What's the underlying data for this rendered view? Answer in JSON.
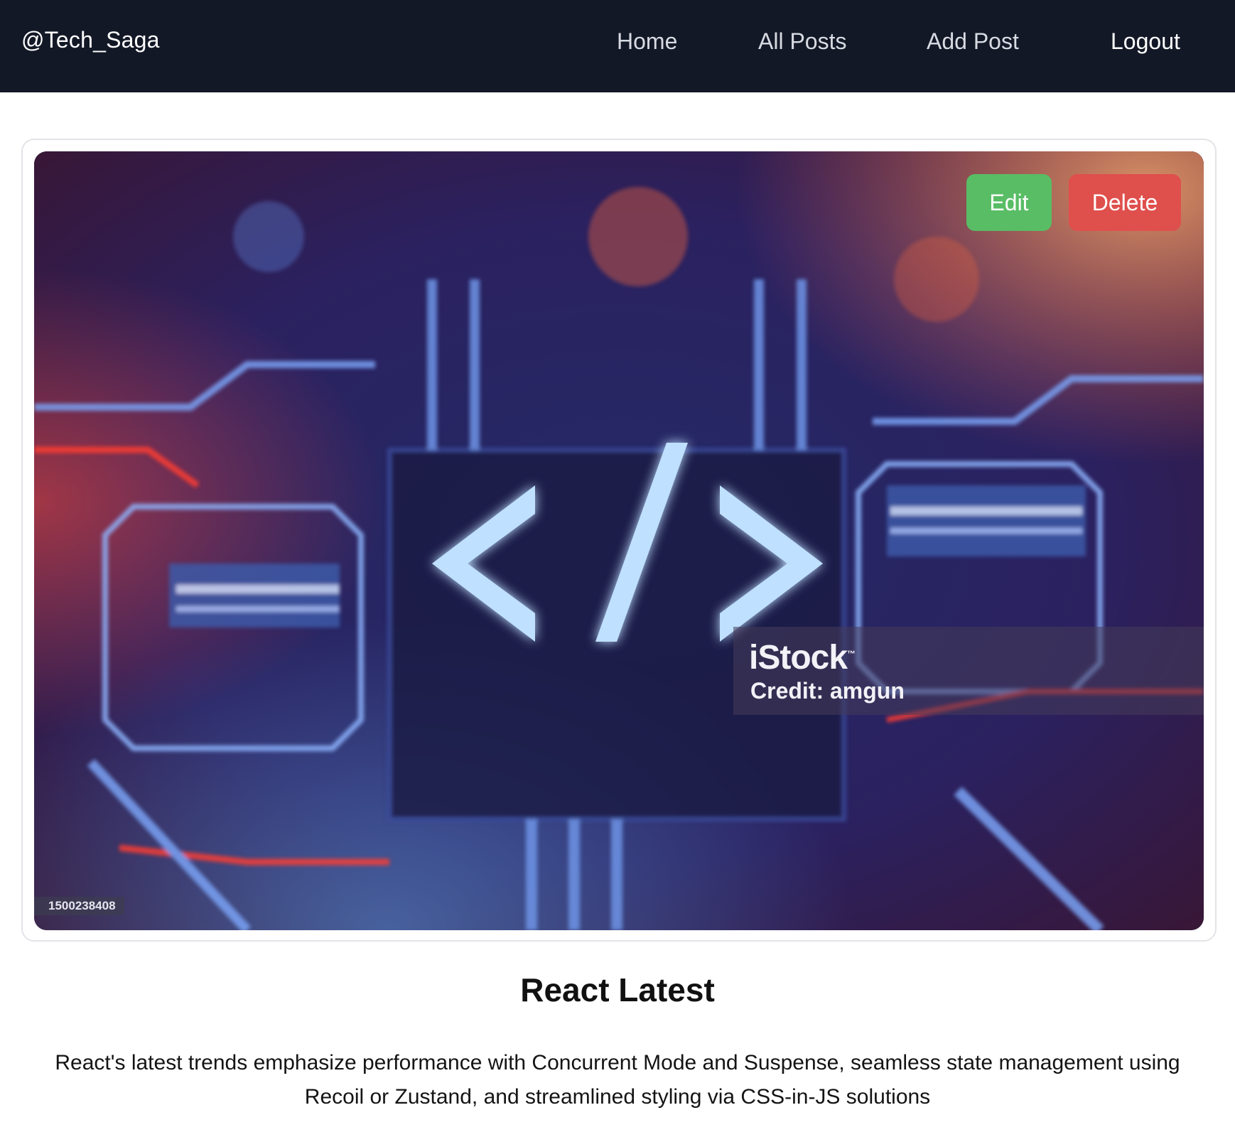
{
  "navbar": {
    "brand": "@Tech_Saga",
    "links": [
      {
        "label": "Home"
      },
      {
        "label": "All Posts"
      },
      {
        "label": "Add Post"
      },
      {
        "label": "Logout"
      }
    ]
  },
  "post": {
    "actions": {
      "edit_label": "Edit",
      "delete_label": "Delete"
    },
    "image": {
      "watermark_brand": "iStock",
      "watermark_trademark": "™",
      "watermark_credit": "Credit: amgun",
      "image_id": "1500238408",
      "glyph": "</>"
    },
    "title": "React Latest",
    "body": "React's latest trends emphasize performance with Concurrent Mode and Suspense, seamless state management using Recoil or Zustand, and streamlined styling via CSS-in-JS solutions"
  },
  "colors": {
    "navbar_bg": "#131827",
    "edit_button": "#59bd65",
    "delete_button": "#df4f4c"
  }
}
